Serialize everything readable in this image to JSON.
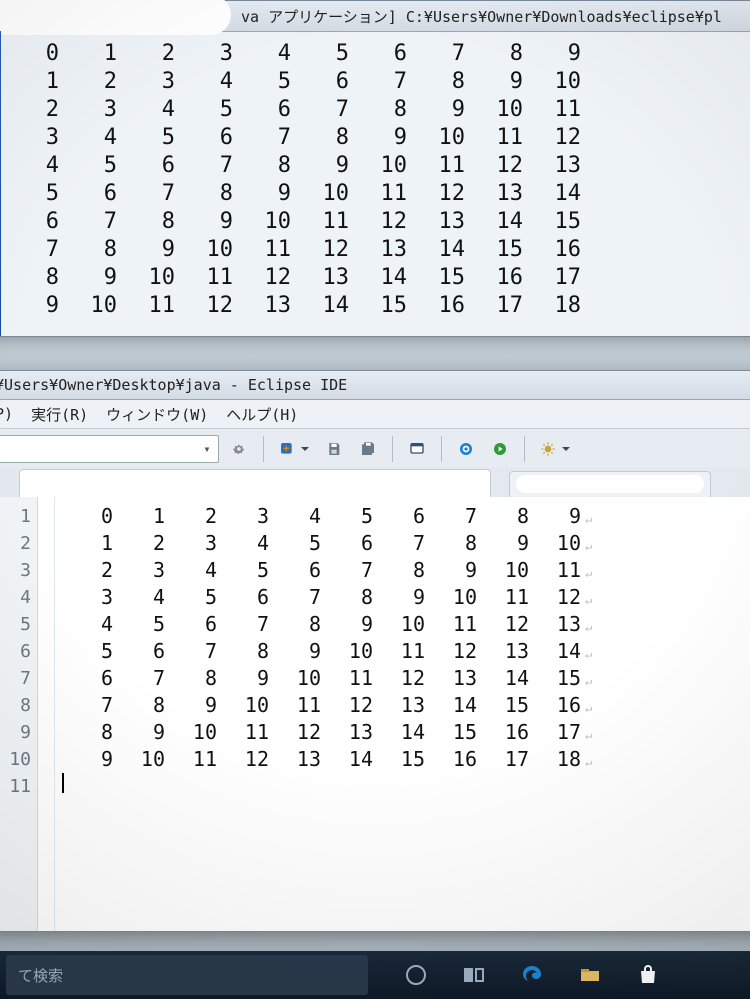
{
  "top_window": {
    "title_suffix": "va アプリケーション] C:¥Users¥Owner¥Downloads¥eclipse¥pl",
    "rows": [
      [
        0,
        1,
        2,
        3,
        4,
        5,
        6,
        7,
        8,
        9
      ],
      [
        1,
        2,
        3,
        4,
        5,
        6,
        7,
        8,
        9,
        10
      ],
      [
        2,
        3,
        4,
        5,
        6,
        7,
        8,
        9,
        10,
        11
      ],
      [
        3,
        4,
        5,
        6,
        7,
        8,
        9,
        10,
        11,
        12
      ],
      [
        4,
        5,
        6,
        7,
        8,
        9,
        10,
        11,
        12,
        13
      ],
      [
        5,
        6,
        7,
        8,
        9,
        10,
        11,
        12,
        13,
        14
      ],
      [
        6,
        7,
        8,
        9,
        10,
        11,
        12,
        13,
        14,
        15
      ],
      [
        7,
        8,
        9,
        10,
        11,
        12,
        13,
        14,
        15,
        16
      ],
      [
        8,
        9,
        10,
        11,
        12,
        13,
        14,
        15,
        16,
        17
      ],
      [
        9,
        10,
        11,
        12,
        13,
        14,
        15,
        16,
        17,
        18
      ]
    ]
  },
  "eclipse": {
    "title": "¥Users¥Owner¥Desktop¥java - Eclipse IDE",
    "menu": [
      "P)",
      "実行(R)",
      "ウィンドウ(W)",
      "ヘルプ(H)"
    ],
    "editor": {
      "line_numbers": [
        1,
        2,
        3,
        4,
        5,
        6,
        7,
        8,
        9,
        10,
        11
      ],
      "rows": [
        [
          0,
          1,
          2,
          3,
          4,
          5,
          6,
          7,
          8,
          9
        ],
        [
          1,
          2,
          3,
          4,
          5,
          6,
          7,
          8,
          9,
          10
        ],
        [
          2,
          3,
          4,
          5,
          6,
          7,
          8,
          9,
          10,
          11
        ],
        [
          3,
          4,
          5,
          6,
          7,
          8,
          9,
          10,
          11,
          12
        ],
        [
          4,
          5,
          6,
          7,
          8,
          9,
          10,
          11,
          12,
          13
        ],
        [
          5,
          6,
          7,
          8,
          9,
          10,
          11,
          12,
          13,
          14
        ],
        [
          6,
          7,
          8,
          9,
          10,
          11,
          12,
          13,
          14,
          15
        ],
        [
          7,
          8,
          9,
          10,
          11,
          12,
          13,
          14,
          15,
          16
        ],
        [
          8,
          9,
          10,
          11,
          12,
          13,
          14,
          15,
          16,
          17
        ],
        [
          9,
          10,
          11,
          12,
          13,
          14,
          15,
          16,
          17,
          18
        ]
      ]
    }
  },
  "taskbar": {
    "search_placeholder": "て検索"
  }
}
